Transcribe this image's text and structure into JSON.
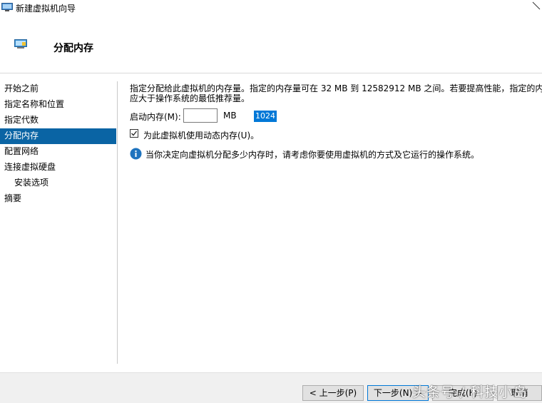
{
  "window": {
    "title": "新建虚拟机向导"
  },
  "header": {
    "title": "分配内存"
  },
  "nav": {
    "items": [
      {
        "label": "开始之前"
      },
      {
        "label": "指定名称和位置"
      },
      {
        "label": "指定代数"
      },
      {
        "label": "分配内存"
      },
      {
        "label": "配置网络"
      },
      {
        "label": "连接虚拟硬盘"
      },
      {
        "label": "安装选项"
      },
      {
        "label": "摘要"
      }
    ]
  },
  "content": {
    "description_line1": "指定分配给此虚拟机的内存量。指定的内存量可在 32 MB 到 12582912 MB 之间。若要提高性能，指定的内存量",
    "description_line2": "应大于操作系统的最低推荐量。",
    "startup_memory_label": "启动内存(M):",
    "startup_memory_value": "1024",
    "memory_unit": "MB",
    "dynamic_memory_label": "为此虚拟机使用动态内存(U)。",
    "info_text": "当你决定向虚拟机分配多少内存时，请考虑你要使用虚拟机的方式及它运行的操作系统。"
  },
  "footer": {
    "previous": "< 上一步(P)",
    "next": "下一步(N) >",
    "finish": "完成(F)",
    "cancel": "取消"
  },
  "watermark": "头条号 / 科技小岛",
  "colors": {
    "selection": "#0a64a4",
    "input_highlight": "#0078d7",
    "info_icon": "#1e73be"
  }
}
